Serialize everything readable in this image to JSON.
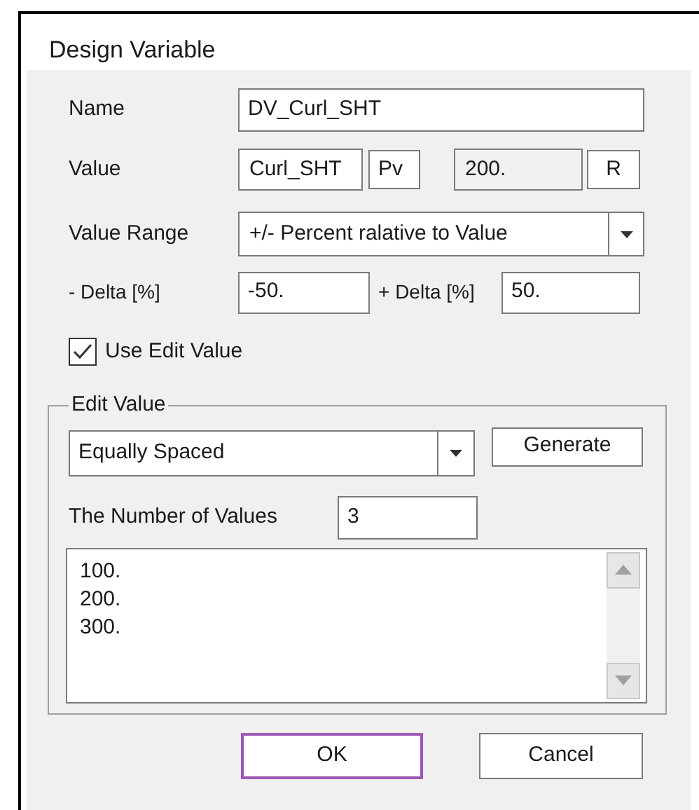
{
  "window": {
    "title": "Design Variable"
  },
  "name": {
    "label": "Name",
    "value": "DV_Curl_SHT"
  },
  "value": {
    "label": "Value",
    "expression": "Curl_SHT",
    "expression_button": "Pv",
    "result": "200.",
    "result_button": "R"
  },
  "value_range": {
    "label": "Value Range",
    "selected": "+/- Percent ralative to Value"
  },
  "minus_delta": {
    "label": "- Delta [%]",
    "value": "-50."
  },
  "plus_delta": {
    "label": "+ Delta [%]",
    "value": "50."
  },
  "use_edit_value": {
    "label": "Use Edit Value",
    "checked": true
  },
  "edit_value": {
    "title": "Edit Value",
    "method": "Equally Spaced",
    "generate_button": "Generate",
    "count_label": "The Number of Values",
    "count": "3",
    "values": [
      "100.",
      "200.",
      "300."
    ]
  },
  "buttons": [
    {
      "label": "OK",
      "focused": true
    },
    {
      "label": "Cancel",
      "focused": false
    }
  ]
}
